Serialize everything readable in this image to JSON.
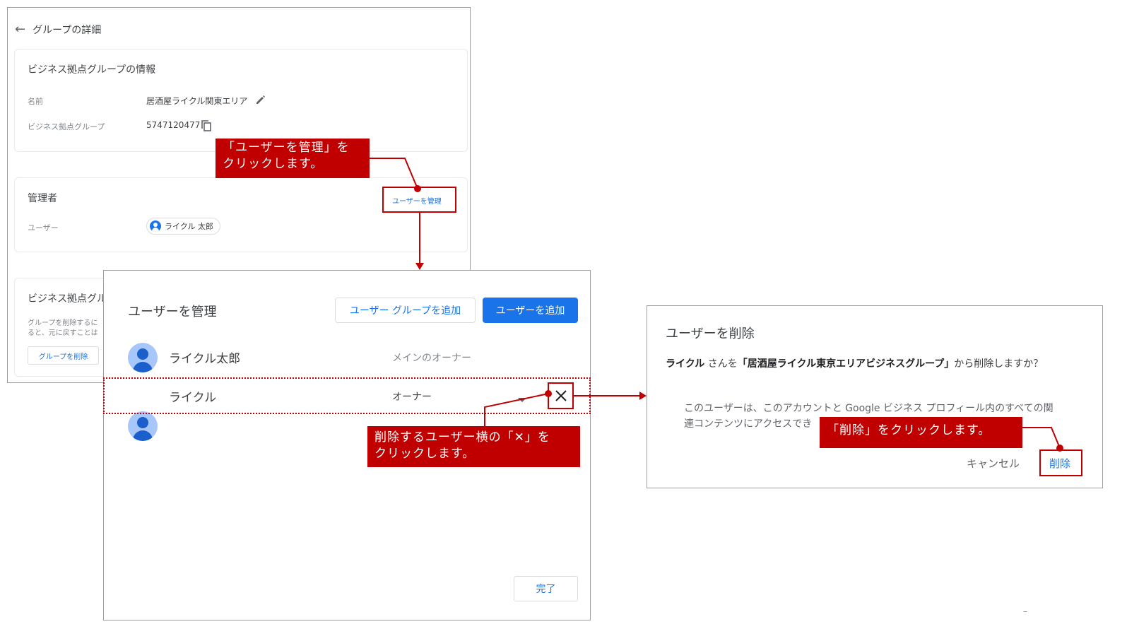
{
  "colors": {
    "accent": "#1a73e8",
    "annotation_red": "#c00000",
    "avatar_light": "#a7c7fa",
    "avatar_dark": "#1a5fcc"
  },
  "details": {
    "header_title": "グループの詳細",
    "back_icon": "arrow-left-icon",
    "info_card": {
      "title": "ビジネス拠点グループの情報",
      "name_label": "名前",
      "name_value": "居酒屋ライクル関東エリア",
      "edit_icon": "pencil-icon",
      "group_label": "ビジネス拠点グループ",
      "group_value": "5747120477",
      "copy_icon": "copy-icon"
    },
    "admin_card": {
      "title": "管理者",
      "manage_link": "ユーザーを管理",
      "user_label": "ユーザー",
      "user_chip": "ライクル 太郎",
      "chip_icon": "account-circle-icon"
    },
    "delete_card": {
      "title": "ビジネス拠点グル",
      "desc_line1": "グループを削除するに",
      "desc_line2": "ると、元に戻すことは",
      "delete_button": "グループを削除"
    }
  },
  "manage_dialog": {
    "title": "ユーザーを管理",
    "add_group_button": "ユーザー グループを追加",
    "add_user_button": "ユーザーを追加",
    "users": [
      {
        "name": "ライクル太郎",
        "role": "メインのオーナー"
      },
      {
        "name": "ライクル",
        "role": "オーナー"
      }
    ],
    "dropdown_icon": "caret-down-icon",
    "remove_icon": "close-icon",
    "done_button": "完了"
  },
  "delete_dialog": {
    "title": "ユーザーを削除",
    "q_user": "ライクル",
    "q_mid": " さんを",
    "q_group": "「居酒屋ライクル東京エリアビジネスグループ」",
    "q_end": "から削除しますか？",
    "body_line1": "このユーザーは、このアカウントと Google ビジネス プロフィール内のすべての関",
    "body_line2": "連コンテンツにアクセスでき",
    "cancel_button": "キャンセル",
    "delete_button": "削除"
  },
  "annotations": {
    "callout1_line1": "「ユーザーを管理」を",
    "callout1_line2": "クリックします。",
    "callout2_line1": "削除するユーザー横の「✕」を",
    "callout2_line2": "クリックします。",
    "callout3": "「削除」をクリックします。"
  },
  "footer_mark": "–"
}
